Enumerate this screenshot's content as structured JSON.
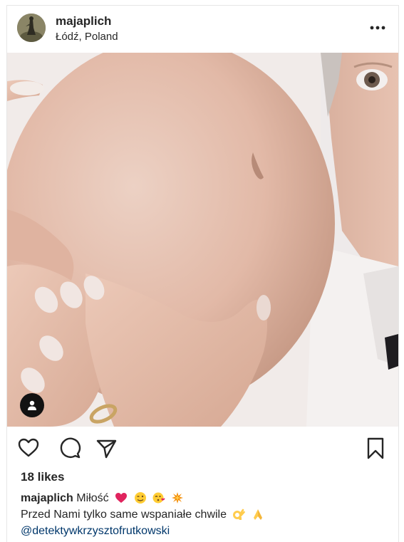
{
  "post": {
    "username": "majaplich",
    "location": "Łódź, Poland",
    "more_icon": "ellipsis-icon",
    "likes": "18 likes",
    "caption": {
      "username": "majaplich",
      "text_line1": "Miłość",
      "emojis_line1": [
        "red-heart",
        "winking-face",
        "face-blowing-kiss",
        "collision"
      ],
      "text_line2": "Przed Nami tylko same wspaniałe chwile",
      "emojis_line2": [
        "ok-hand",
        "folded-hands"
      ],
      "mention": "@detektywkrzysztofrutkowski"
    },
    "actions": {
      "like_icon": "heart-icon",
      "comment_icon": "comment-icon",
      "share_icon": "paper-plane-icon",
      "save_icon": "bookmark-icon"
    }
  },
  "colors": {
    "text": "#262626",
    "mention": "#00376b",
    "skin": "#e8c3b3",
    "background": "#ffffff"
  }
}
